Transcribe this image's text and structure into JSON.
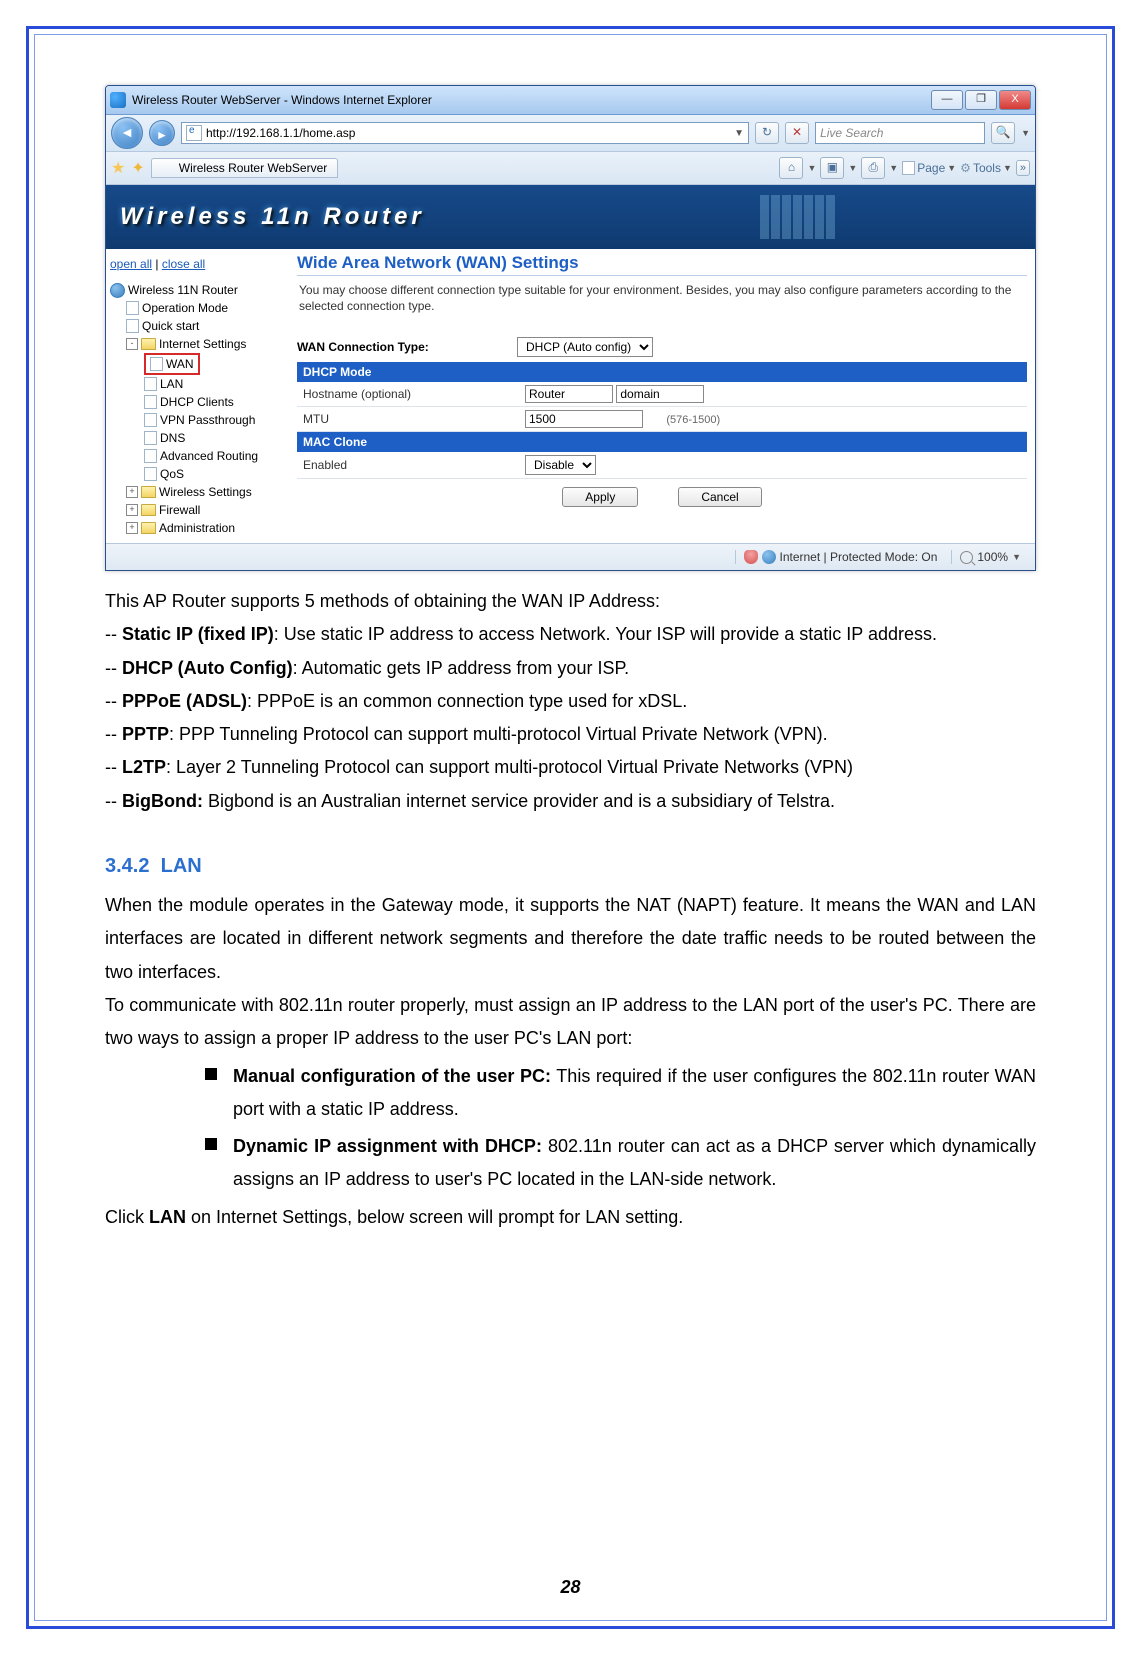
{
  "browser": {
    "titleText": "Wireless Router WebServer - Windows Internet Explorer",
    "winButtons": {
      "min": "—",
      "max": "❐",
      "close": "X"
    },
    "url": "http://192.168.1.1/home.asp",
    "refreshGlyph": "↻",
    "stopGlyph": "✕",
    "searchPlaceholder": "Live Search",
    "searchGlyph": "🔍",
    "tabLabel": "Wireless Router WebServer",
    "tools": {
      "home": "⌂",
      "feed": "▣",
      "print": "⎙",
      "page": "Page",
      "tool": "Tools"
    }
  },
  "router": {
    "bannerText": "Wireless 11n Router",
    "side": {
      "openAll": "open all",
      "closeAll": "close all",
      "root": "Wireless 11N Router",
      "items": {
        "opMode": "Operation Mode",
        "quick": "Quick start",
        "inet": "Internet Settings",
        "wan": "WAN",
        "lan": "LAN",
        "dhcp": "DHCP Clients",
        "vpn": "VPN Passthrough",
        "dns": "DNS",
        "adv": "Advanced Routing",
        "qos": "QoS",
        "wless": "Wireless Settings",
        "fw": "Firewall",
        "admin": "Administration"
      }
    },
    "page": {
      "title": "Wide Area Network (WAN) Settings",
      "desc": "You may choose different connection type suitable for your environment. Besides, you may also configure parameters according to the selected connection type.",
      "connTypeLabel": "WAN Connection Type:",
      "connTypeValue": "DHCP (Auto config)",
      "dhcpHdr": "DHCP Mode",
      "hostLabel": "Hostname (optional)",
      "hostVal": "Router",
      "domainVal": "domain",
      "mtuLabel": "MTU",
      "mtuVal": "1500",
      "mtuRange": "(576-1500)",
      "macHdr": "MAC Clone",
      "enabledLabel": "Enabled",
      "enabledVal": "Disable",
      "apply": "Apply",
      "cancel": "Cancel"
    },
    "status": {
      "mode": "Internet | Protected Mode: On",
      "zoom": "100%"
    }
  },
  "doc": {
    "intro": "This AP Router supports 5 methods of obtaining the WAN IP Address:",
    "m1b": "Static IP (fixed IP)",
    "m1": ": Use static IP address to access Network. Your ISP will provide a static IP address.",
    "m2b": "DHCP (Auto Config)",
    "m2": ": Automatic gets IP address from your ISP.",
    "m3b": "PPPoE (ADSL)",
    "m3": ": PPPoE is an common connection type used for xDSL.",
    "m4b": "PPTP",
    "m4": ": PPP Tunneling Protocol can support multi-protocol Virtual Private Network (VPN).",
    "m5b": "L2TP",
    "m5": ": Layer 2 Tunneling Protocol can support multi-protocol Virtual Private Networks (VPN)",
    "m6b": "BigBond:",
    "m6": " Bigbond is an Australian internet service provider and is a subsidiary of Telstra.",
    "secNum": "3.4.2",
    "secTitle": "LAN",
    "p1": "When the module operates in the Gateway mode, it supports the NAT (NAPT) feature. It means the WAN and LAN interfaces are located in different network segments and therefore the date traffic needs to be routed between the two interfaces.",
    "p2": "To communicate with 802.11n router properly, must assign an IP address to the LAN port of the user's PC. There are two ways to assign a proper IP address to the user PC's LAN port:",
    "b1b": "Manual configuration of the user PC:",
    "b1": " This required if the user configures the 802.11n router WAN port with a static IP address.",
    "b2b": "Dynamic IP assignment with DHCP:",
    "b2": " 802.11n router can act as a DHCP server which dynamically assigns an IP address to user's PC located in the LAN-side network.",
    "p3a": "Click ",
    "p3b": "LAN",
    "p3c": " on Internet Settings, below screen will prompt for LAN setting.",
    "pageNum": "28"
  }
}
